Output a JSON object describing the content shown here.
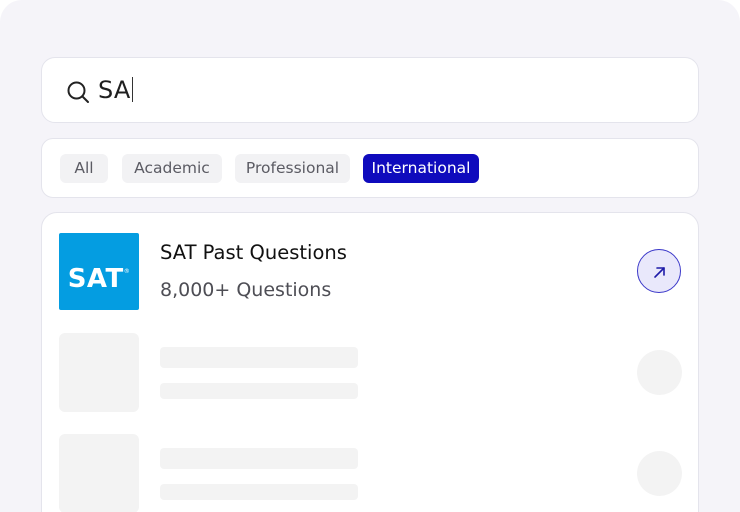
{
  "search": {
    "value": "SA",
    "icon": "search-icon"
  },
  "filters": [
    {
      "label": "All",
      "active": false
    },
    {
      "label": "Academic",
      "active": false
    },
    {
      "label": "Professional",
      "active": false
    },
    {
      "label": "International",
      "active": true
    }
  ],
  "results": [
    {
      "logo_text": "SAT",
      "logo_mark": "®",
      "title": "SAT Past Questions",
      "subtitle": "8,000+ Questions",
      "action_icon": "arrow-up-right-icon"
    }
  ],
  "loading_placeholders": 2,
  "colors": {
    "accent": "#0f0bbd",
    "logo_bg": "#049de1",
    "background": "#f5f4f9"
  }
}
